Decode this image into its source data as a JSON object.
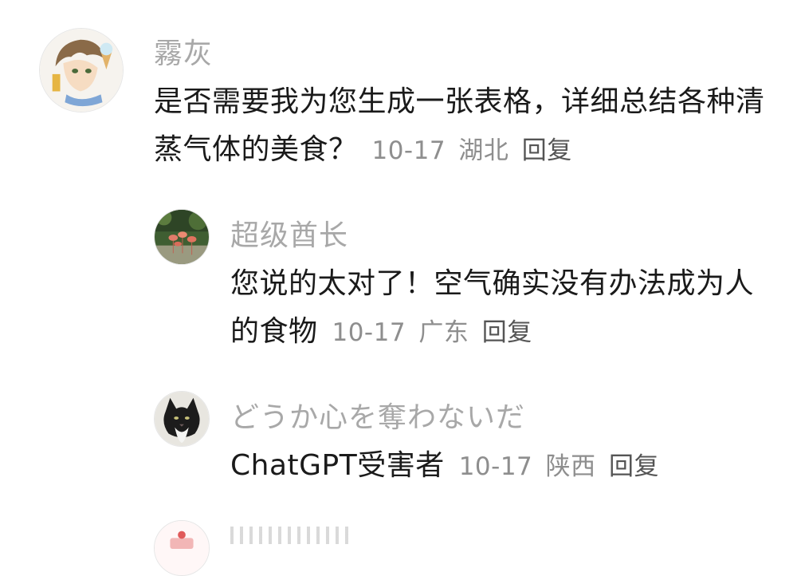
{
  "comments": [
    {
      "username": "霧灰",
      "text": "是否需要我为您生成一张表格，详细总结各种清蒸气体的美食？",
      "date": "10-17",
      "location": "湖北",
      "reply_label": "回复",
      "avatar_icon": "anime-boy-avatar-icon"
    },
    {
      "username": "超级酋长",
      "text": "您说的太对了！空气确实没有办法成为人的食物",
      "date": "10-17",
      "location": "广东",
      "reply_label": "回复",
      "avatar_icon": "flamingo-photo-avatar-icon"
    },
    {
      "username": "どうか心を奪わないだ",
      "text": "ChatGPT受害者",
      "date": "10-17",
      "location": "陕西",
      "reply_label": "回复",
      "avatar_icon": "cat-photo-avatar-icon"
    }
  ],
  "colors": {
    "username": "#a8a8a8",
    "text": "#1a1a1a",
    "meta": "#8e8e8e",
    "reply": "#555555"
  }
}
